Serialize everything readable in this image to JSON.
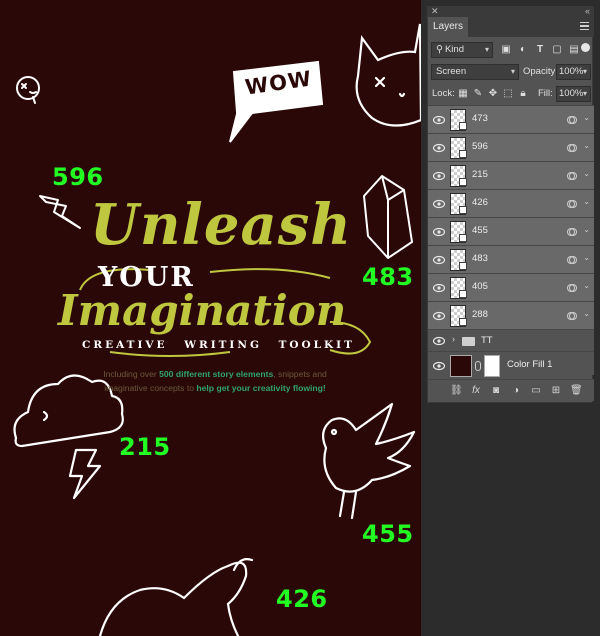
{
  "panel": {
    "tab_label": "Layers",
    "filter_label": "Kind",
    "blend_mode": "Screen",
    "opacity_label": "Opacity:",
    "opacity_value": "100%",
    "lock_label": "Lock:",
    "fill_label": "Fill:",
    "fill_value": "100%"
  },
  "layers": [
    {
      "name": "473",
      "kind": "smart-object",
      "visible": true
    },
    {
      "name": "596",
      "kind": "smart-object",
      "visible": true
    },
    {
      "name": "215",
      "kind": "smart-object",
      "visible": true
    },
    {
      "name": "426",
      "kind": "smart-object",
      "visible": true
    },
    {
      "name": "455",
      "kind": "smart-object",
      "visible": true
    },
    {
      "name": "483",
      "kind": "smart-object",
      "visible": true
    },
    {
      "name": "405",
      "kind": "smart-object",
      "visible": true
    },
    {
      "name": "288",
      "kind": "smart-object",
      "visible": true
    },
    {
      "name": "TT",
      "kind": "group",
      "visible": true
    },
    {
      "name": "Color Fill 1",
      "kind": "color-fill",
      "visible": true
    }
  ],
  "canvas": {
    "background_color": "#2a0808",
    "speech_text": "WOW",
    "title_line1": "Unleash",
    "title_line2": "YOUR",
    "title_line3": "Imagination",
    "subtitle": "CREATIVE WRITING TOOLKIT",
    "desc_a": "Including over ",
    "desc_b": "500 different story elements",
    "desc_c": ", snippets and imaginative concepts to ",
    "desc_d": "help get your creativity flowing!",
    "labels": {
      "l596": "596",
      "l483": "483",
      "l215": "215",
      "l455": "455",
      "l426": "426"
    }
  },
  "colors": {
    "accent_olive": "#bfc73f",
    "label_green": "#22ff22",
    "highlight_green": "#2fa46c",
    "panel_bg": "#535353",
    "selected_row": "#696969"
  }
}
